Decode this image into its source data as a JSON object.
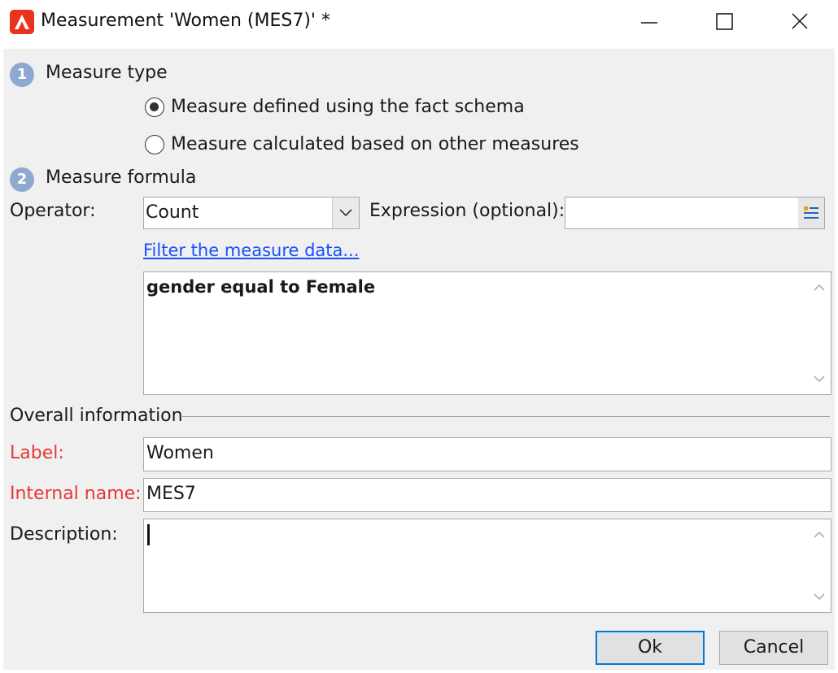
{
  "window": {
    "title": "Measurement 'Women (MES7)' *",
    "icon": "adobe-campaign-icon",
    "controls": [
      "minimize-icon",
      "maximize-icon",
      "close-icon"
    ]
  },
  "section1": {
    "number": "1",
    "title": "Measure type",
    "options": [
      {
        "label": "Measure defined using the fact schema",
        "selected": true
      },
      {
        "label": "Measure calculated based on other measures",
        "selected": false
      }
    ]
  },
  "section2": {
    "number": "2",
    "title": "Measure formula",
    "operator_label": "Operator:",
    "operator_value": "Count",
    "expression_label": "Expression (optional):",
    "expression_value": "",
    "filter_link": "Filter the measure data...",
    "filter_text": "gender equal to Female"
  },
  "overall": {
    "title": "Overall information",
    "label_label": "Label:",
    "label_value": "Women",
    "internal_label": "Internal name:",
    "internal_value": "MES7",
    "description_label": "Description:",
    "description_value": ""
  },
  "buttons": {
    "ok": "Ok",
    "cancel": "Cancel"
  },
  "colors": {
    "required": "#e53935",
    "link": "#1a4fff",
    "step_badge": "#8fa8cf",
    "default_button_border": "#0078d7",
    "app_icon": "#e8341c"
  }
}
